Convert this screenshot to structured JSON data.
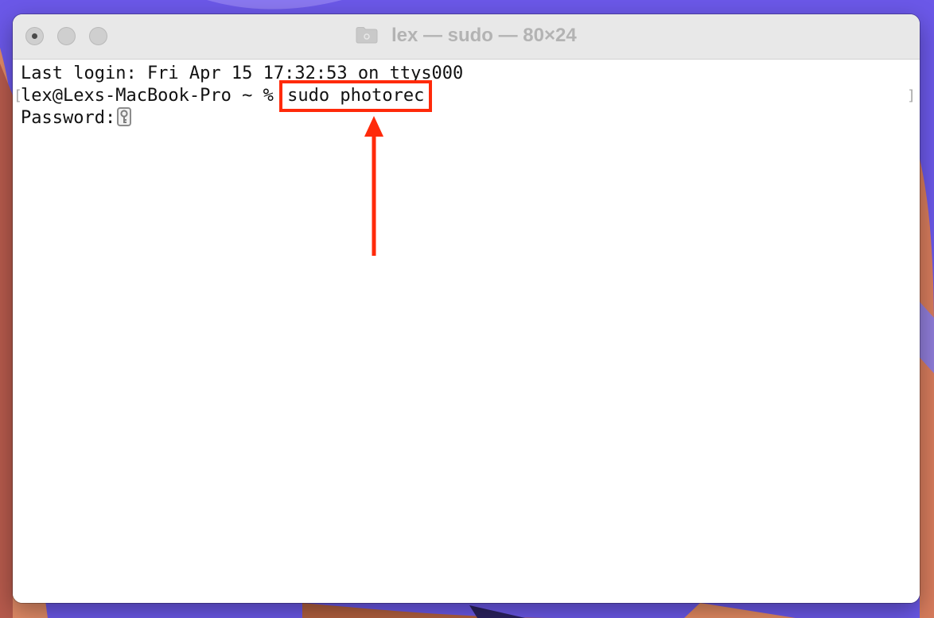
{
  "window": {
    "title": "lex — sudo — 80×24"
  },
  "terminal": {
    "last_login": "Last login: Fri Apr 15 17:32:53 on ttys000",
    "prompt": "lex@Lexs-MacBook-Pro ~ % ",
    "command": "sudo photorec",
    "password_label": "Password:",
    "bracket_left": "[",
    "bracket_right": "]"
  },
  "annotation": {
    "highlight_color": "#ff2a0a",
    "arrow_color": "#ff2a0a"
  },
  "icons": [
    "folder-icon",
    "key-icon"
  ]
}
